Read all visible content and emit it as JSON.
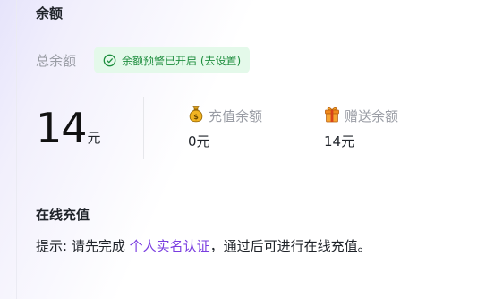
{
  "balance": {
    "title": "余额",
    "total_label": "总余额",
    "alert_text": "余额预警已开启 (去设置)",
    "alert_icon": "check-circle-icon",
    "alert_color": "#1e8e3e",
    "total_amount": "14",
    "total_unit": "元",
    "recharge": {
      "icon": "money-bag-icon",
      "label": "充值余额",
      "value": "0元"
    },
    "gift": {
      "icon": "gift-icon",
      "label": "赠送余额",
      "value": "14元"
    }
  },
  "online_recharge": {
    "title": "在线充值",
    "hint_prefix": "提示: 请先完成 ",
    "hint_link": "个人实名认证",
    "hint_suffix": "，通过后可进行在线充值。",
    "link_color": "#7a3de0"
  }
}
